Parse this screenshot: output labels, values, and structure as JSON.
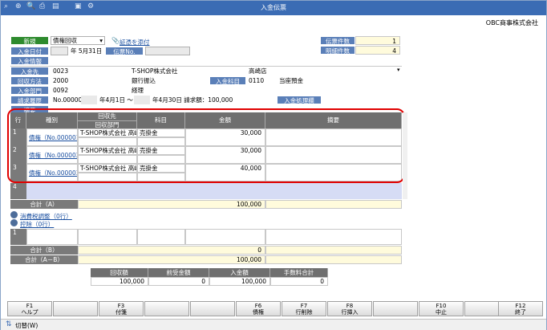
{
  "window": {
    "title": "入金伝票",
    "company": "OBC商事株式会社"
  },
  "header": {
    "new_label": "新規",
    "slip_type": "債権回収",
    "attach_link": "証憑を添付",
    "entry_date_label": "入金日付",
    "entry_date_value": "年  5月31日",
    "slip_no_label": "伝票No.",
    "entry_info_label": "入金情報",
    "payer_label": "入金先",
    "payer_code": "0023",
    "payer_name": "T-SHOP株式会社",
    "payer_branch": "高崎店",
    "method_label": "回収方法",
    "method_code": "2000",
    "method_name": "銀行振込",
    "account_label": "入金科目",
    "account_code": "0110",
    "account_name": "当座預金",
    "dept_label": "入金部門",
    "dept_code": "0092",
    "dept_name": "経理",
    "invoice_label": "請求履歴",
    "invoice_value": "No.000001",
    "invoice_period_1": "年4月1日 ～",
    "invoice_period_2": "年4月30日  請求額：100,000",
    "process_btn": "入金処理欄",
    "memo_label": "摘要",
    "slip_count_label": "伝票件数",
    "slip_count": "1",
    "detail_count_label": "明細件数",
    "detail_count": "4"
  },
  "grid": {
    "headers": {
      "row": "行",
      "kind": "種別",
      "collect_to": "回収先",
      "collect_dept": "回収部門",
      "subject": "科目",
      "amount": "金額",
      "memo": "摘要"
    },
    "rows": [
      {
        "no": "1",
        "kind": "債権（No.000001",
        "to": "T-SHOP株式会社 高崎",
        "subject": "売掛金",
        "amount": "30,000"
      },
      {
        "no": "2",
        "kind": "債権（No.000002",
        "to": "T-SHOP株式会社 高崎",
        "subject": "売掛金",
        "amount": "30,000"
      },
      {
        "no": "3",
        "kind": "債権（No.000003",
        "to": "T-SHOP株式会社 高崎",
        "subject": "売掛金",
        "amount": "40,000"
      },
      {
        "no": "4",
        "kind": "",
        "to": "",
        "subject": "",
        "amount": ""
      }
    ],
    "total_a_label": "合計（A）",
    "total_a": "100,000"
  },
  "tax_link": "消費税調整（0行）",
  "deduct_link": "控除（0行）",
  "grid2": {
    "row_no": "1",
    "total_b_label": "合計（B）",
    "total_b": "0",
    "total_ab_label": "合計（A－B）",
    "total_ab": "100,000"
  },
  "summary": {
    "headers": [
      "回収額",
      "前受金額",
      "入金額",
      "手数料合計"
    ],
    "values": [
      "100,000",
      "0",
      "100,000",
      "0"
    ]
  },
  "fkeys": [
    {
      "key": "F1",
      "label": "ヘルプ"
    },
    {
      "key": "",
      "label": ""
    },
    {
      "key": "F3",
      "label": "付箋"
    },
    {
      "key": "",
      "label": ""
    },
    {
      "key": "",
      "label": ""
    },
    {
      "key": "F6",
      "label": "債権"
    },
    {
      "key": "F7",
      "label": "行削除"
    },
    {
      "key": "F8",
      "label": "行挿入"
    },
    {
      "key": "",
      "label": ""
    },
    {
      "key": "F10",
      "label": "中止"
    },
    {
      "key": "",
      "label": ""
    },
    {
      "key": "F12",
      "label": "終了"
    }
  ],
  "status": {
    "toggle_label": "切替(W)"
  }
}
